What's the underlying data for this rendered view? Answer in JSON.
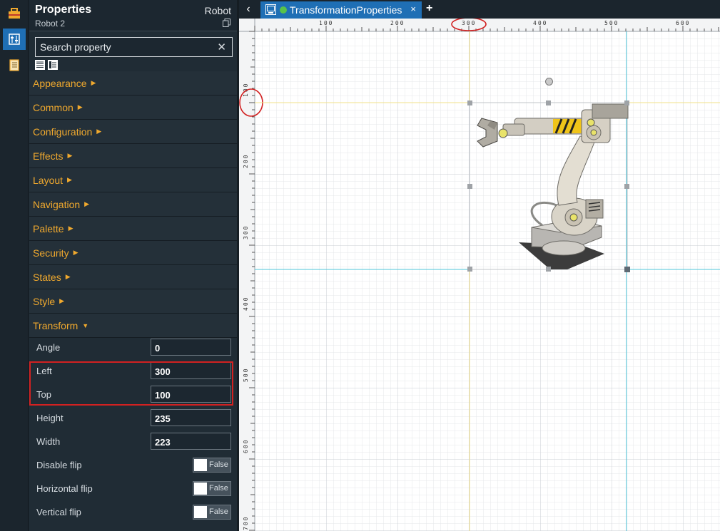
{
  "iconbar": {
    "items": [
      {
        "icon": "toolbox-icon",
        "active": false
      },
      {
        "icon": "properties-icon",
        "active": true
      },
      {
        "icon": "notebook-icon",
        "active": false
      }
    ]
  },
  "panel": {
    "title": "Properties",
    "subtitle": "Robot 2",
    "type": "Robot",
    "search": {
      "value": "",
      "placeholder": "Search property"
    },
    "sections": [
      {
        "label": "Appearance",
        "open": false
      },
      {
        "label": "Common",
        "open": false
      },
      {
        "label": "Configuration",
        "open": false
      },
      {
        "label": "Effects",
        "open": false
      },
      {
        "label": "Layout",
        "open": false
      },
      {
        "label": "Navigation",
        "open": false
      },
      {
        "label": "Palette",
        "open": false
      },
      {
        "label": "Security",
        "open": false
      },
      {
        "label": "States",
        "open": false
      },
      {
        "label": "Style",
        "open": false
      },
      {
        "label": "Transform",
        "open": true
      }
    ],
    "transform": {
      "angle": {
        "label": "Angle",
        "value": "0"
      },
      "left": {
        "label": "Left",
        "value": "300"
      },
      "top": {
        "label": "Top",
        "value": "100"
      },
      "height": {
        "label": "Height",
        "value": "235"
      },
      "width": {
        "label": "Width",
        "value": "223"
      },
      "disable_flip": {
        "label": "Disable flip",
        "value": "False"
      },
      "horizontal_flip": {
        "label": "Horizontal flip",
        "value": "False"
      },
      "vertical_flip": {
        "label": "Vertical flip",
        "value": "False"
      }
    }
  },
  "tabs": {
    "active": {
      "label": "TransformationProperties",
      "status_color": "#58c24a"
    },
    "close_glyph": "×",
    "add_glyph": "+",
    "back_glyph": "‹"
  },
  "ruler": {
    "h_labels": [
      "100",
      "200",
      "300",
      "400",
      "500",
      "600"
    ],
    "v_labels": [
      "100",
      "200",
      "300",
      "400",
      "500",
      "600",
      "700"
    ]
  },
  "colors": {
    "accent": "#1f6fb5",
    "section_label": "#f0a92e",
    "highlight": "#d22121",
    "guide_yellow": "#f2e08a",
    "guide_cyan": "#4cc4d9"
  }
}
